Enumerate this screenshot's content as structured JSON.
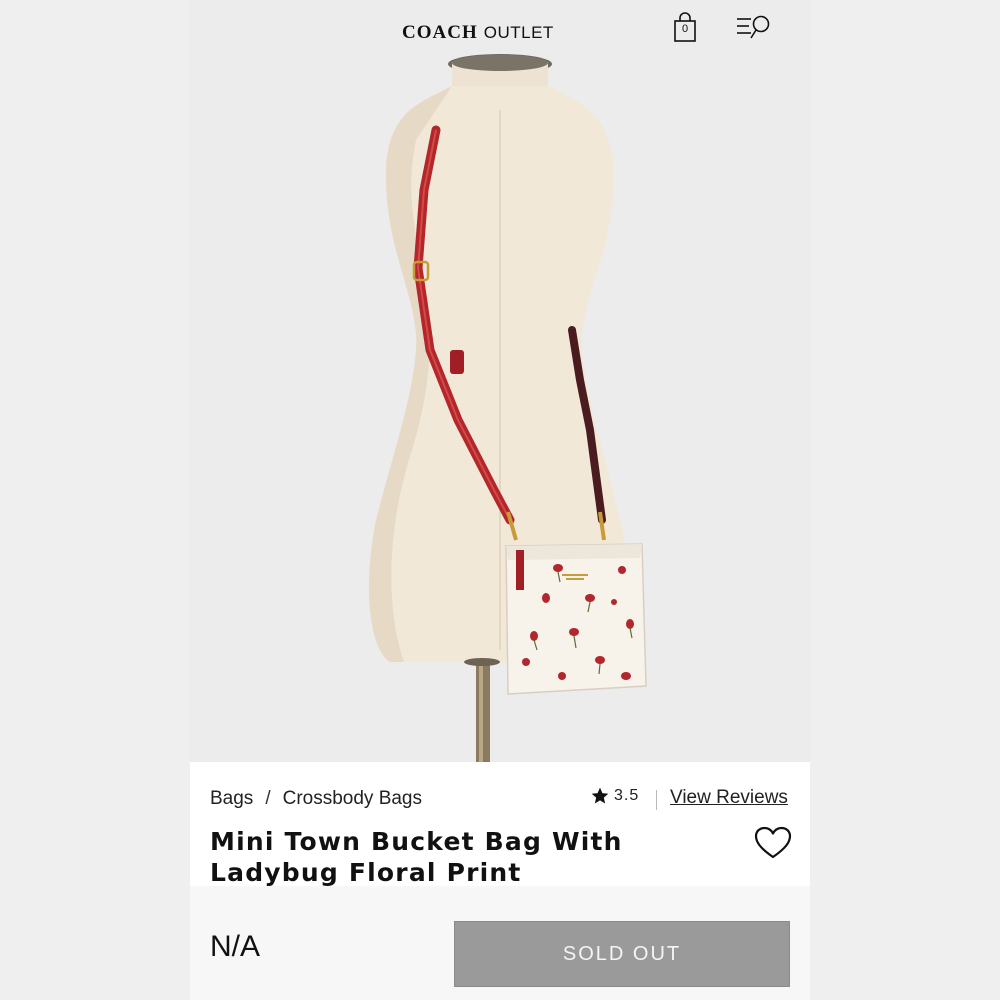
{
  "header": {
    "brand": "COACH",
    "brand_sub": "OUTLET",
    "bag_count": "0"
  },
  "carousel": {
    "total_slides": 5,
    "active_slide": 4
  },
  "breadcrumb": {
    "items": [
      "Bags",
      "Crossbody Bags"
    ],
    "separator": "/"
  },
  "rating": {
    "value": "3.5",
    "reviews_link": "View Reviews"
  },
  "product": {
    "title": "Mini Town Bucket Bag With Ladybug Floral Print"
  },
  "purchase": {
    "price": "N/A",
    "button_label": "SOLD OUT"
  },
  "icons": {
    "bag": "shopping-bag-icon",
    "menu": "menu-search-icon",
    "star": "star-icon",
    "wishlist": "heart-icon"
  },
  "colors": {
    "sold_out_button": "#9a9a9a",
    "strap_red": "#b3262c",
    "background": "#ececec"
  }
}
